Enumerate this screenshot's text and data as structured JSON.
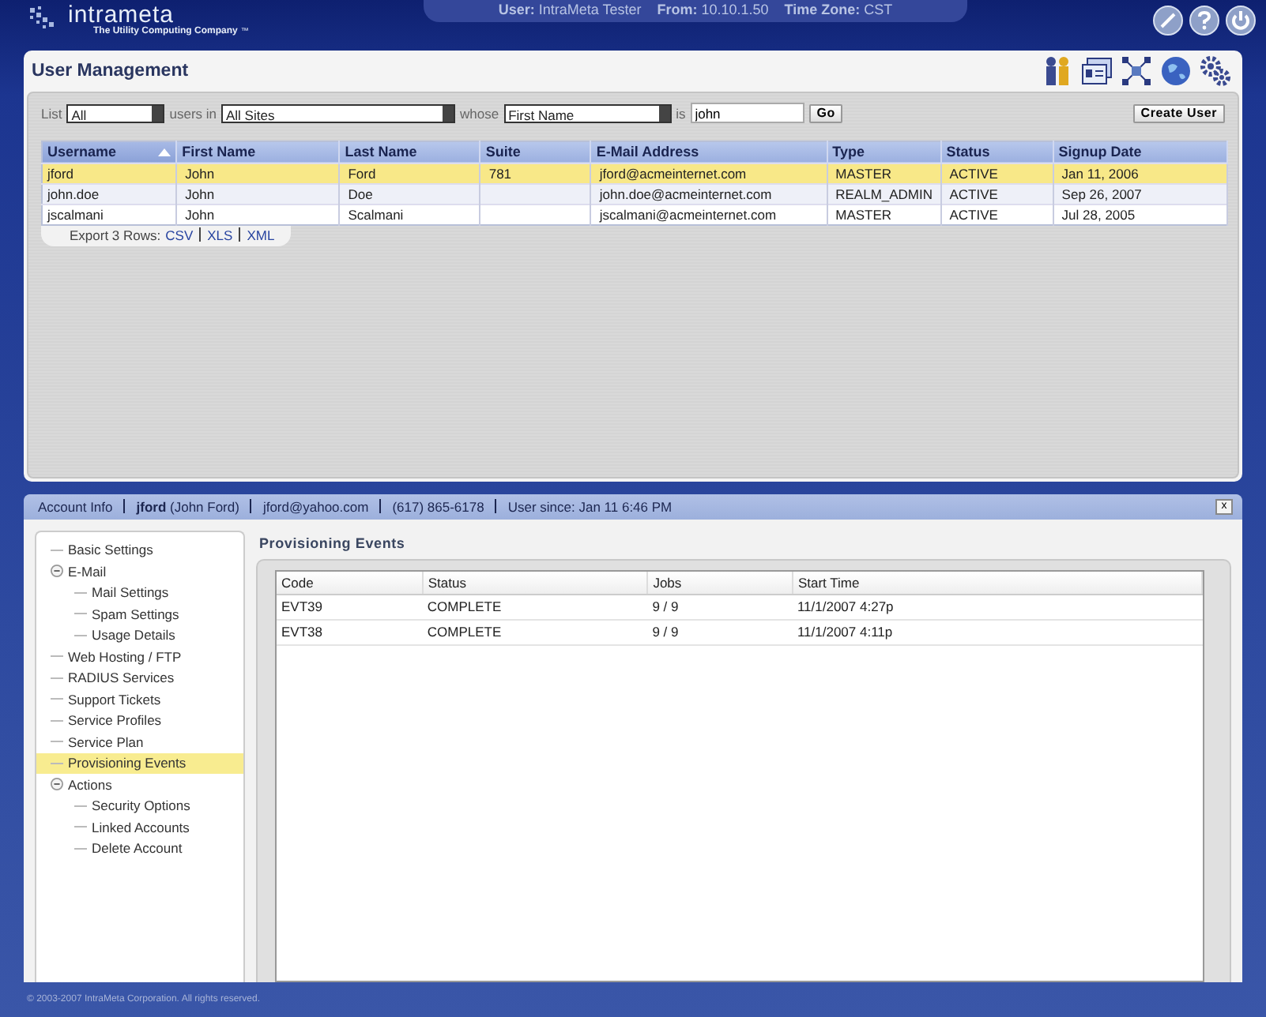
{
  "header": {
    "logo": "intrameta",
    "tagline": "The Utility Computing Company",
    "trademark": "™",
    "session": [
      {
        "label": "User:",
        "value": "IntraMeta Tester"
      },
      {
        "label": "From:",
        "value": "10.10.1.50"
      },
      {
        "label": "Time Zone:",
        "value": "CST"
      }
    ]
  },
  "page_title": "User Management",
  "filter": {
    "list_label": "List",
    "list_value": "All",
    "in_label": "users in",
    "site_value": "All Sites",
    "whose_label": "whose",
    "field_value": "First Name",
    "is_label": "is",
    "query": "john",
    "go": "Go",
    "create": "Create User"
  },
  "users": {
    "columns": [
      {
        "label": "Username",
        "sorted": true
      },
      {
        "label": "First Name",
        "sorted": false
      },
      {
        "label": "Last Name",
        "sorted": false
      },
      {
        "label": "Suite",
        "sorted": false
      },
      {
        "label": "E-Mail Address",
        "sorted": false
      },
      {
        "label": "Type",
        "sorted": false
      },
      {
        "label": "Status",
        "sorted": false
      },
      {
        "label": "Signup Date",
        "sorted": false
      }
    ],
    "rows": [
      {
        "selected": true,
        "cells": [
          "jford",
          "John",
          "Ford",
          "781",
          "jford@acmeinternet.com",
          "MASTER",
          "ACTIVE",
          "Jan 11, 2006"
        ]
      },
      {
        "selected": false,
        "cells": [
          "john.doe",
          "John",
          "Doe",
          "",
          "john.doe@acmeinternet.com",
          "REALM_ADMIN",
          "ACTIVE",
          "Sep 26, 2007"
        ]
      },
      {
        "selected": false,
        "cells": [
          "jscalmani",
          "John",
          "Scalmani",
          "",
          "jscalmani@acmeinternet.com",
          "MASTER",
          "ACTIVE",
          "Jul 28, 2005"
        ]
      }
    ]
  },
  "export": {
    "label": "Export 3 Rows:",
    "links": [
      "CSV",
      "XLS",
      "XML"
    ]
  },
  "account_bar": {
    "items": [
      "Account Info",
      "**jford** (John Ford)",
      "jford@yahoo.com",
      "(617) 865-6178",
      "User since: Jan 11 6:46 PM"
    ],
    "close": "x"
  },
  "tree": [
    {
      "label": "Basic Settings",
      "selected": false
    },
    {
      "label": "E-Mail",
      "selected": false,
      "expanded": true,
      "children": [
        {
          "label": "Mail Settings",
          "selected": false
        },
        {
          "label": "Spam Settings",
          "selected": false
        },
        {
          "label": "Usage Details",
          "selected": false
        }
      ]
    },
    {
      "label": "Web Hosting / FTP",
      "selected": false
    },
    {
      "label": "RADIUS Services",
      "selected": false
    },
    {
      "label": "Support Tickets",
      "selected": false
    },
    {
      "label": "Service Profiles",
      "selected": false
    },
    {
      "label": "Service Plan",
      "selected": false
    },
    {
      "label": "Provisioning Events",
      "selected": true
    },
    {
      "label": "Actions",
      "selected": false,
      "expanded": true,
      "children": [
        {
          "label": "Security Options",
          "selected": false
        },
        {
          "label": "Linked Accounts",
          "selected": false
        },
        {
          "label": "Delete Account",
          "selected": false
        }
      ]
    }
  ],
  "events": {
    "title": "Provisioning Events",
    "columns": [
      "Code",
      "Status",
      "Jobs",
      "Start Time"
    ],
    "rows": [
      [
        "EVT39",
        "COMPLETE",
        "9 / 9",
        "11/1/2007 4:27p"
      ],
      [
        "EVT38",
        "COMPLETE",
        "9 / 9",
        "11/1/2007 4:11p"
      ]
    ]
  },
  "footer": "© 2003-2007 IntraMeta Corporation.  All rights reserved."
}
